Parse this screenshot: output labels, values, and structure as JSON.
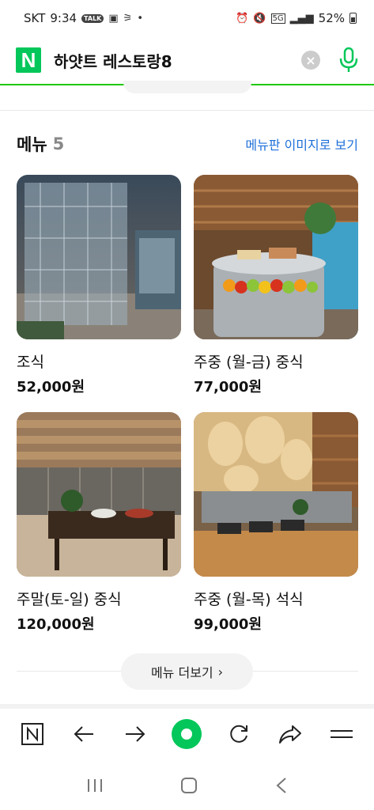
{
  "status_bar": {
    "carrier": "SKT",
    "time": "9:34",
    "talk_badge": "TALK",
    "battery": "52%"
  },
  "search": {
    "query": "하얏트 레스토랑8",
    "logo_letter": "N",
    "accent_color": "#03c75a"
  },
  "menu_section": {
    "title": "메뉴",
    "count": "5",
    "image_link": "메뉴판 이미지로 보기",
    "items": [
      {
        "name": "조식",
        "price": "52,000원",
        "photo": "wine-cellar-glass-photo"
      },
      {
        "name": "주중 (월-금) 중식",
        "price": "77,000원",
        "photo": "fruit-buffet-counter-photo"
      },
      {
        "name": "주말(토-일) 중식",
        "price": "120,000원",
        "photo": "wood-buffet-table-photo"
      },
      {
        "name": "주중 (월-목) 석식",
        "price": "99,000원",
        "photo": "open-kitchen-buffet-photo"
      }
    ],
    "more_button": "메뉴 더보기"
  },
  "browser_toolbar": {
    "icons": [
      "naver-n-icon",
      "back-arrow-icon",
      "forward-arrow-icon",
      "home-icon",
      "refresh-icon",
      "share-icon",
      "menu-icon"
    ]
  },
  "system_nav": {
    "icons": [
      "recent-apps-icon",
      "home-square-icon",
      "back-chevron-icon"
    ]
  }
}
